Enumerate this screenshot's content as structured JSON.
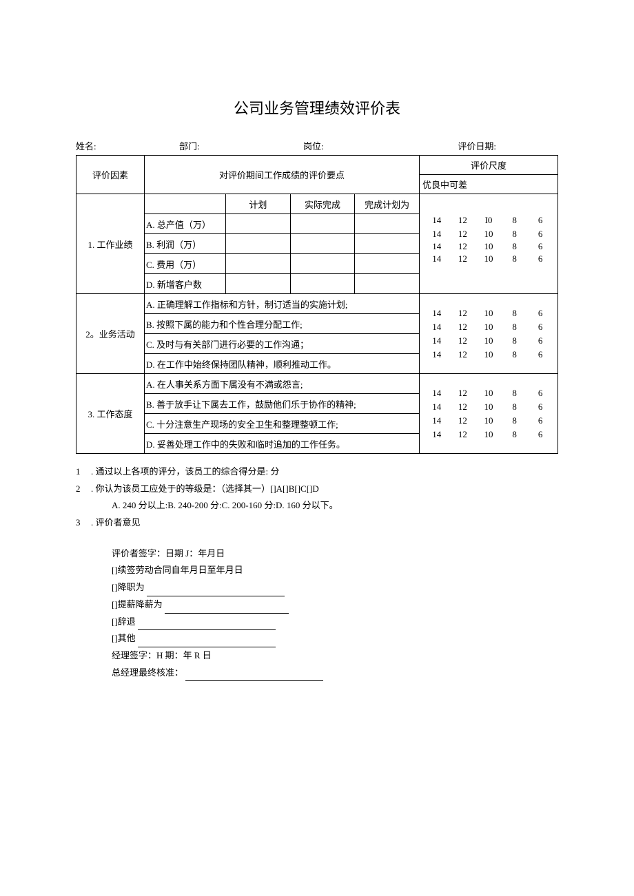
{
  "title": "公司业务管理绩效评价表",
  "header": {
    "name_label": "姓名:",
    "dept_label": "部门:",
    "post_label": "岗位:",
    "date_label": "评价日期:"
  },
  "table": {
    "col_factor": "评价因素",
    "col_points": "对评价期间工作成绩的评价要点",
    "col_scale": "评价尺度",
    "scale_levels": "优良中可差",
    "sec1": {
      "label": "1. 工作业绩",
      "head_plan": "计划",
      "head_actual": "实际完成",
      "head_ratio": "完成计划为",
      "rows": [
        "A. 总产值（万）",
        "B. 利润（万）",
        "C. 费用（万）",
        "D. 新增客户数"
      ],
      "scores": [
        [
          "14",
          "12",
          "I0",
          "8",
          "6"
        ],
        [
          "14",
          "12",
          "10",
          "8",
          "6"
        ],
        [
          "14",
          "12",
          "10",
          "8",
          "6"
        ],
        [
          "14",
          "12",
          "10",
          "8",
          "6"
        ]
      ]
    },
    "sec2": {
      "label": "2。业务活动",
      "rows": [
        "A. 正确理解工作指标和方针，制订适当的实施计划;",
        "B. 按照下属的能力和个性合理分配工作;",
        "C. 及时与有关部门进行必要的工作沟通；",
        "D. 在工作中始终保持团队精神，顺利推动工作。"
      ],
      "scores": [
        [
          "14",
          "12",
          "10",
          "8",
          "6"
        ],
        [
          "14",
          "12",
          "10",
          "8",
          "6"
        ],
        [
          "14",
          "12",
          "10",
          "8",
          "6"
        ],
        [
          "14",
          "12",
          "10",
          "8",
          "6"
        ]
      ]
    },
    "sec3": {
      "label": "3. 工作态度",
      "rows": [
        "A. 在人事关系方面下属没有不满或怨言;",
        "B. 善于放手让下属去工作，鼓励他们乐于协作的精神;",
        "C. 十分注意生产现场的安全卫生和整理整顿工作;",
        "D. 妥善处理工作中的失败和临时追加的工作任务。"
      ],
      "scores": [
        [
          "14",
          "12",
          "10",
          "8",
          "6"
        ],
        [
          "14",
          "12",
          "10",
          "8",
          "6"
        ],
        [
          "14",
          "12",
          "10",
          "8",
          "6"
        ],
        [
          "14",
          "12",
          "10",
          "8",
          "6"
        ]
      ]
    }
  },
  "notes": {
    "n1_num": "1",
    "n1": ". 通过以上各项的评分，该员工的综合得分是: 分",
    "n2_num": "2",
    "n2": ". 你认为该员工应处于的等级是：（选择其一）[]A[]B[]C[]D",
    "n2b": "A. 240 分以上:B. 240-200 分:C. 200-160 分:D. 160 分以下。",
    "n3_num": "3",
    "n3": ". 评价者意见"
  },
  "sig": {
    "l1": "评价者签字：日期 J：年月日",
    "l2": "[]续签劳动合同自年月日至年月日",
    "l3": "[]降职为",
    "l4": "[]提薪降薪为",
    "l5": "[]辞退",
    "l6": "[]其他",
    "l7": "经理签字：H 期：年 R 日",
    "l8": "总经理最终核准："
  }
}
